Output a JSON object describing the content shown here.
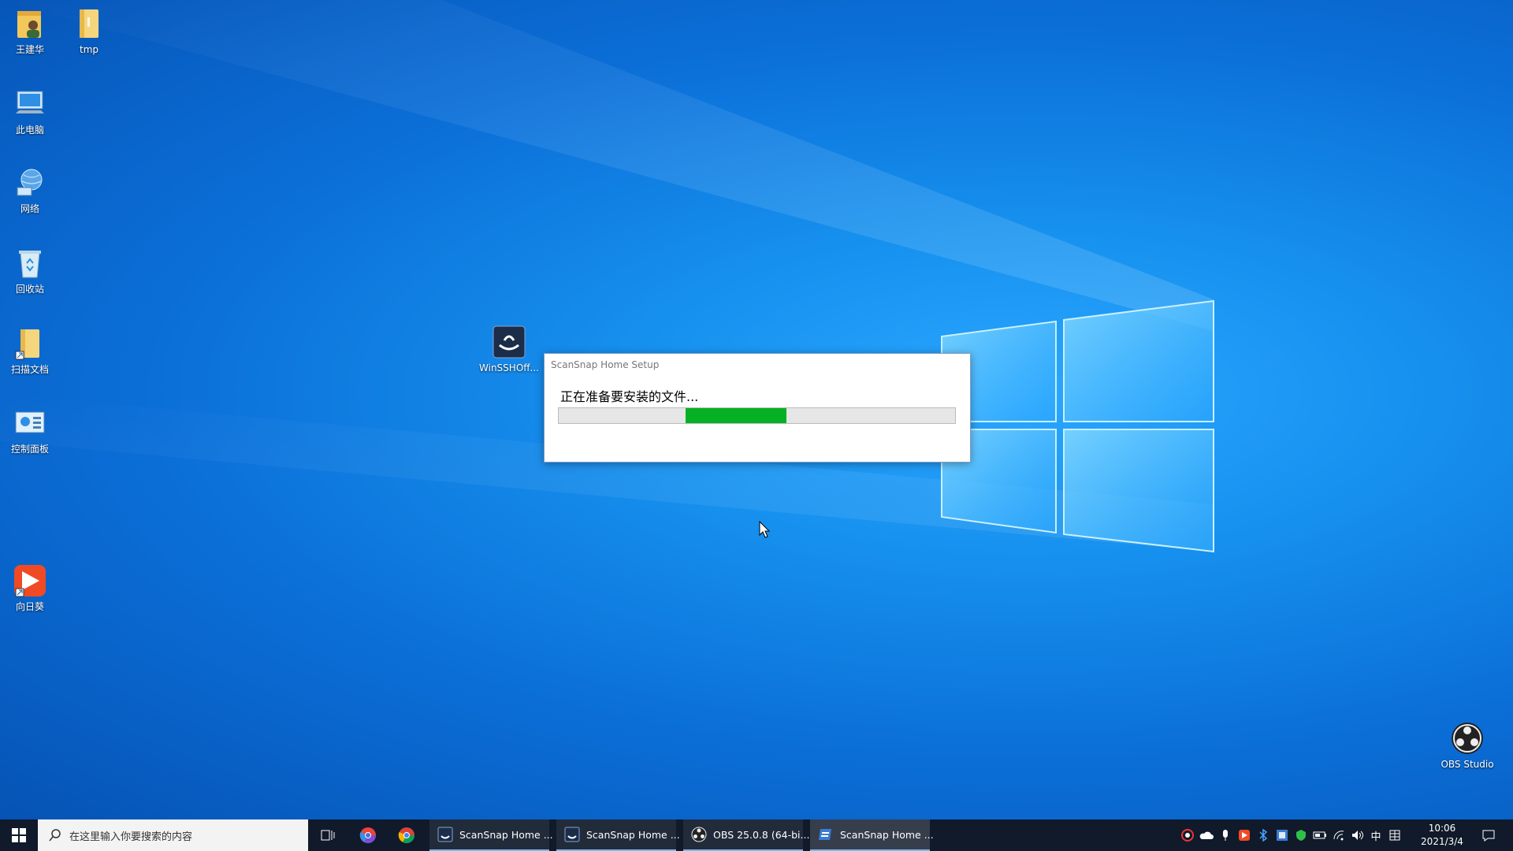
{
  "desktop": {
    "icons": [
      {
        "label": "王建华"
      },
      {
        "label": "tmp"
      },
      {
        "label": "此电脑"
      },
      {
        "label": "网络"
      },
      {
        "label": "回收站"
      },
      {
        "label": "扫描文档"
      },
      {
        "label": "控制面板"
      },
      {
        "label": "向日葵"
      },
      {
        "label": "WinSSHOff..."
      },
      {
        "label": "OBS Studio"
      }
    ]
  },
  "dialog": {
    "title": "ScanSnap Home Setup",
    "status": "正在准备要安装的文件...",
    "progress_color": "#06b025"
  },
  "taskbar": {
    "search_placeholder": "在这里输入你要搜索的内容",
    "apps": [
      {
        "label": "ScanSnap Home ...",
        "icon": "scansnap-icon"
      },
      {
        "label": "ScanSnap Home ...",
        "icon": "scansnap-icon"
      },
      {
        "label": "OBS 25.0.8 (64-bi...",
        "icon": "obs-icon"
      },
      {
        "label": "ScanSnap Home ...",
        "icon": "scansnap-setup-icon"
      }
    ],
    "tray": {
      "ime": "中",
      "time": "10:06",
      "date": "2021/3/4"
    },
    "accent": "#76b9ed"
  }
}
